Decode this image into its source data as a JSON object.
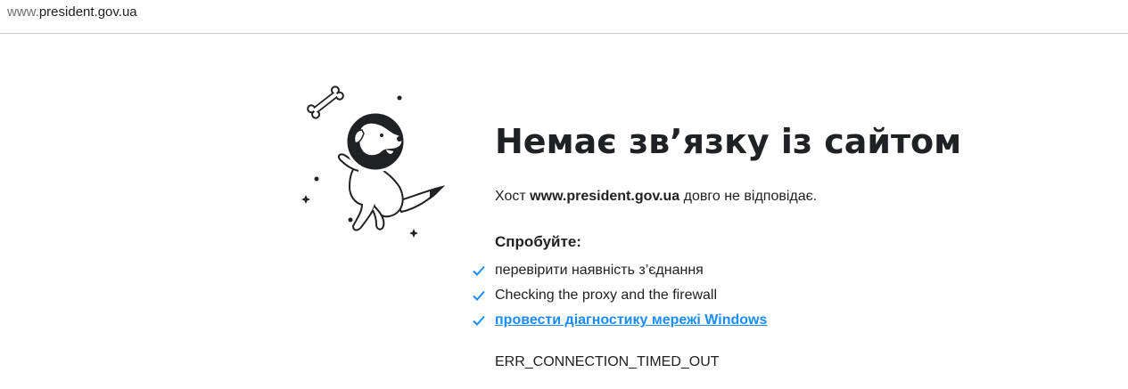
{
  "address_bar": {
    "prefix": "www.",
    "domain": "president.gov.ua"
  },
  "error": {
    "title": "Немає зв’язку із сайтом",
    "host_prefix": "Хост ",
    "host": "www.president.gov.ua",
    "host_suffix": " довго не відповідає.",
    "try_heading": "Спробуйте:",
    "suggestions": [
      "перевірити наявність з’єднання",
      "Checking the proxy and the firewall",
      "провести діагностику мережі Windows"
    ],
    "code": "ERR_CONNECTION_TIMED_OUT"
  },
  "colors": {
    "accent": "#1a8cff",
    "text": "#202124"
  },
  "icons": {
    "illustration": "space-dog-icon",
    "check": "check-icon"
  }
}
